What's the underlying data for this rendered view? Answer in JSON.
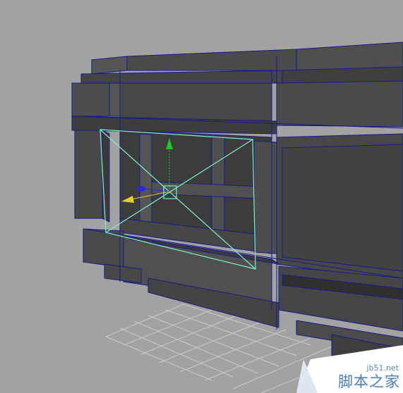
{
  "viewport": {
    "background": "#a2a2a2",
    "mesh_face_color": "#4a4a4a",
    "wireframe_color": "#1a1a8c",
    "grid_color": "#c9c9c9",
    "selected_face_color": "#7cf2c4"
  },
  "manipulator": {
    "y_axis_color": "#22c422",
    "x_axis_color": "#e5d02a",
    "z_axis_color": "#2a2ad6",
    "pivot_color": "#7cf2c4"
  },
  "watermark": {
    "url": "jb51.net",
    "text": "脚本之家"
  }
}
